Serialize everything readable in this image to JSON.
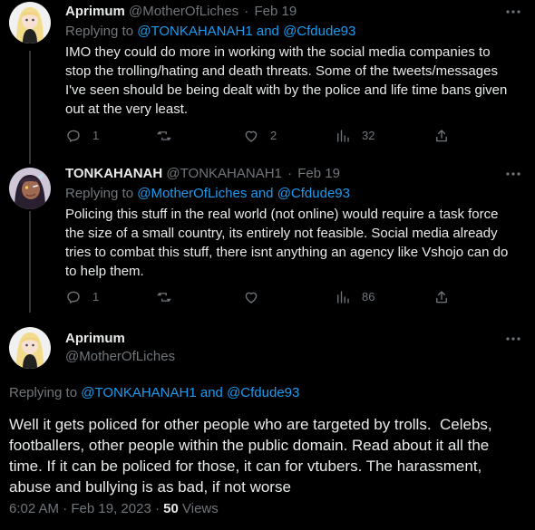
{
  "colors": {
    "background": "#000000",
    "text": "#e7e9ea",
    "muted": "#71767b",
    "link": "#1d9bf0",
    "thread_line": "#333639"
  },
  "tweets": [
    {
      "display_name": "Aprimum",
      "handle": "@MotherOfLiches",
      "separator": "·",
      "date": "Feb 19",
      "replying_prefix": "Replying to ",
      "replying_user1": "@TONKAHANAH1",
      "replying_and": " and ",
      "replying_user2": "@Cfdude93",
      "text": "IMO they could do more in working with the social media companies to\nstop the trolling/hating and death threats. Some of the tweets/messages\nI've seen should be being dealt with by the police and life time bans given\nout at the very least.",
      "replies": "1",
      "retweets": "",
      "likes": "2",
      "views": "32",
      "icons": [
        "reply-icon",
        "retweet-icon",
        "like-icon",
        "views-icon",
        "share-icon",
        "more-icon"
      ]
    },
    {
      "display_name": "TONKAHANAH",
      "handle": "@TONKAHANAH1",
      "separator": "·",
      "date": "Feb 19",
      "replying_prefix": "Replying to ",
      "replying_user1": "@MotherOfLiches",
      "replying_and": " and ",
      "replying_user2": "@Cfdude93",
      "text": "Policing this stuff in the real world (not online) would require a task force\nthe size of a small country, its entirely not feasible. Social media already\ntries to combat this stuff, there isnt anything an agency like Vshojo can do\nto help them.",
      "replies": "1",
      "retweets": "",
      "likes": "",
      "views": "86",
      "icons": [
        "reply-icon",
        "retweet-icon",
        "like-icon",
        "views-icon",
        "share-icon",
        "more-icon"
      ]
    }
  ],
  "main_tweet": {
    "display_name": "Aprimum",
    "handle": "@MotherOfLiches",
    "replying_prefix": "Replying to ",
    "replying_user1": "@TONKAHANAH1",
    "replying_and": " and ",
    "replying_user2": "@Cfdude93",
    "text": "Well it gets policed for other people who are targeted by trolls.  Celebs,\nfootballers, other people within the public domain. Read about it all the\ntime. If it can be policed for those, it can for vtubers. The harassment,\nabuse and bullying is as bad, if not worse",
    "time": "6:02 AM",
    "separator": "·",
    "date": "Feb 19, 2023",
    "separator2": "·",
    "views_count": "50",
    "views_label": "Views"
  }
}
